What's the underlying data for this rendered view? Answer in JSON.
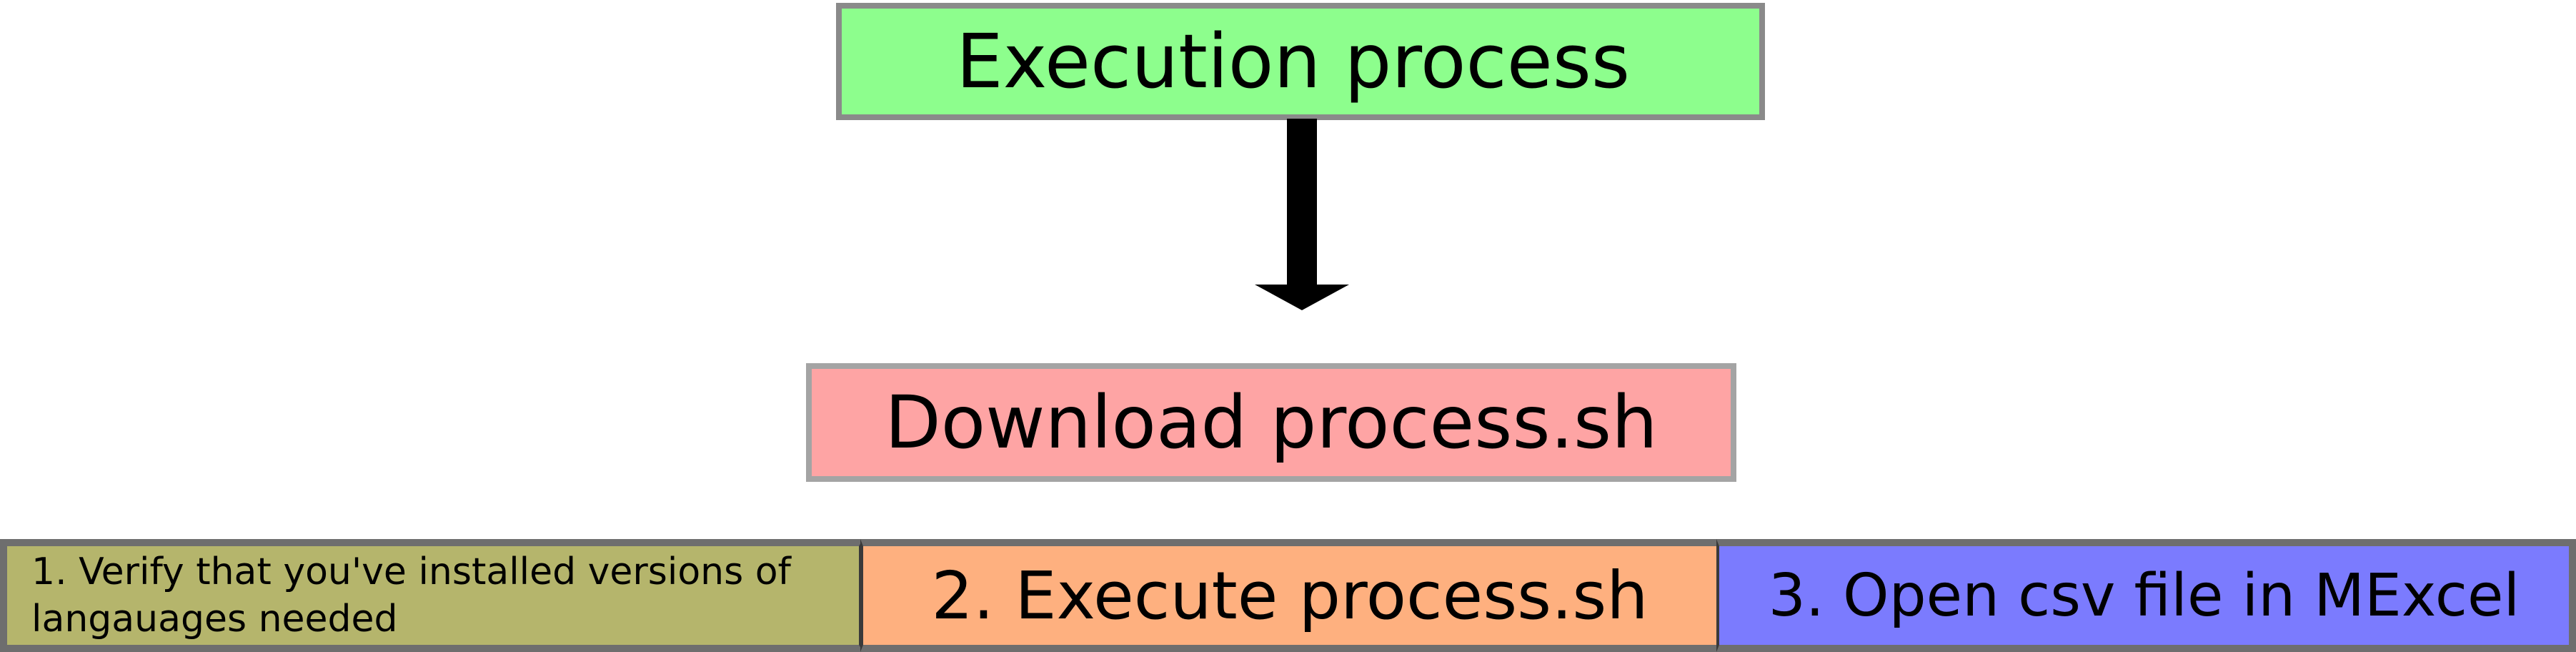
{
  "diagram": {
    "title": "Execution process",
    "download_step": "Download process.sh",
    "steps": [
      {
        "label": "1. Verify that you've installed versions of\nlangauages needed"
      },
      {
        "label": "2. Execute process.sh"
      },
      {
        "label": "3. Open csv file in MExcel"
      }
    ]
  },
  "colors": {
    "title_fill": "#8dfe8d",
    "download_fill": "#fea4a4",
    "step1_fill": "#b5b56c",
    "step2_fill": "#feb07f",
    "step3_fill": "#7b7bfe",
    "arrow": "#000000"
  }
}
